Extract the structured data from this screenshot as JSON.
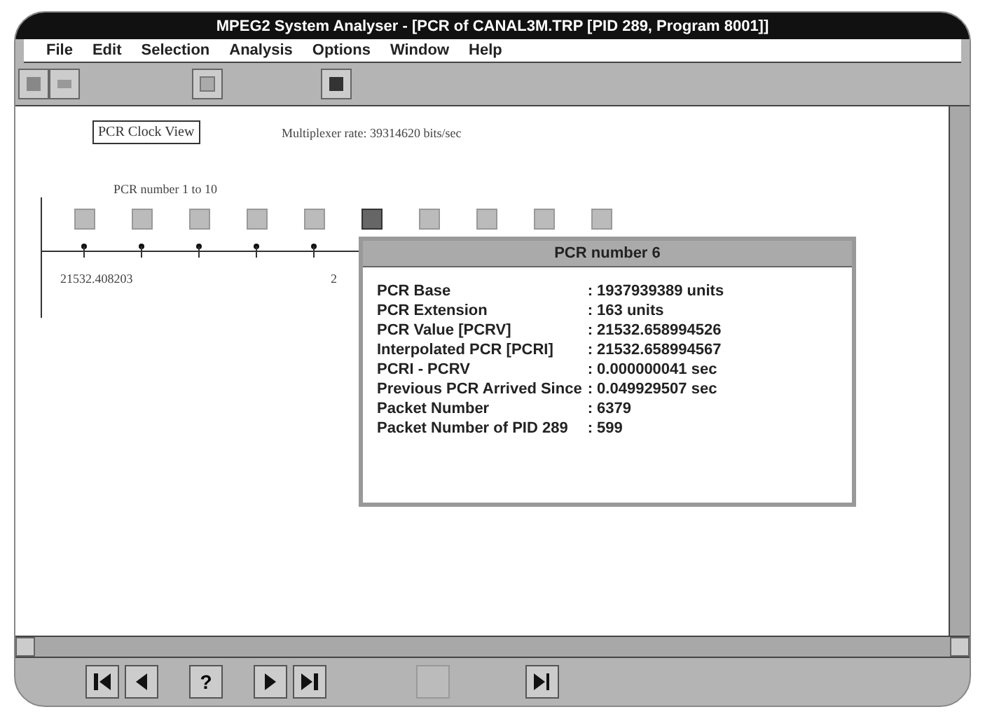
{
  "window": {
    "title": "MPEG2 System Analyser - [PCR of CANAL3M.TRP [PID 289, Program 8001]]"
  },
  "menu": [
    "File",
    "Edit",
    "Selection",
    "Analysis",
    "Options",
    "Window",
    "Help"
  ],
  "view": {
    "label": "PCR Clock View",
    "rate": "Multiplexer rate: 39314620 bits/sec",
    "range": "PCR number 1 to 10"
  },
  "markers": [
    {
      "selected": false
    },
    {
      "selected": false
    },
    {
      "selected": false
    },
    {
      "selected": false
    },
    {
      "selected": false
    },
    {
      "selected": true
    },
    {
      "selected": false
    },
    {
      "selected": false
    },
    {
      "selected": false
    },
    {
      "selected": false
    }
  ],
  "tick_labels": [
    "21532.408203",
    "2"
  ],
  "popup": {
    "title": "PCR number 6",
    "rows": [
      {
        "label": "PCR Base",
        "value": ": 1937939389 units"
      },
      {
        "label": "PCR Extension",
        "value": ": 163 units"
      },
      {
        "label": "PCR Value [PCRV]",
        "value": ": 21532.658994526"
      },
      {
        "label": "Interpolated PCR [PCRI]",
        "value": ": 21532.658994567"
      },
      {
        "label": "PCRI - PCRV",
        "value": ": 0.000000041 sec"
      },
      {
        "label": "Previous PCR Arrived Since",
        "value": ": 0.049929507 sec"
      },
      {
        "label": "Packet Number",
        "value": ": 6379"
      },
      {
        "label": "Packet Number of PID 289",
        "value": ": 599"
      }
    ]
  },
  "nav_buttons": [
    {
      "kind": "first"
    },
    {
      "kind": "prev"
    },
    {
      "kind": "help",
      "label": "?"
    },
    {
      "kind": "next"
    },
    {
      "kind": "last"
    },
    {
      "kind": "blank"
    },
    {
      "kind": "step"
    }
  ]
}
